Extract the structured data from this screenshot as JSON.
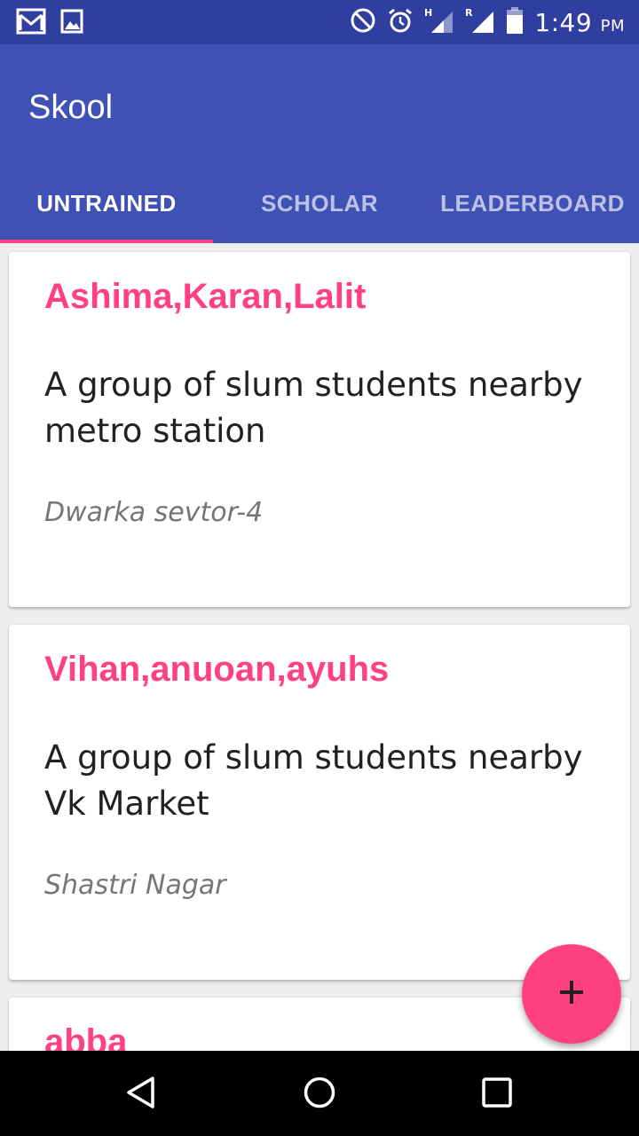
{
  "status_bar": {
    "time": "1:49",
    "ampm": "PM",
    "icons": [
      "gmail-icon",
      "image-icon",
      "do-not-disturb-icon",
      "alarm-icon",
      "signal-h-icon",
      "signal-r-icon",
      "battery-icon"
    ]
  },
  "app": {
    "title": "Skool",
    "accent_color": "#ff4081",
    "primary_color": "#3f51b5"
  },
  "tabs": [
    {
      "label": "UNTRAINED",
      "active": true
    },
    {
      "label": "SCHOLAR",
      "active": false
    },
    {
      "label": "LEADERBOARD",
      "active": false
    }
  ],
  "cards": [
    {
      "title": "Ashima,Karan,Lalit",
      "description": "A group of slum students nearby metro station",
      "location": "Dwarka sevtor-4"
    },
    {
      "title": "Vihan,anuoan,ayuhs",
      "description": "A group of slum students nearby Vk Market",
      "location": "Shastri Nagar"
    },
    {
      "title": "abba"
    }
  ],
  "fab": {
    "icon": "add-icon"
  },
  "nav_bar": {
    "icons": [
      "back-icon",
      "home-icon",
      "recents-icon"
    ]
  }
}
